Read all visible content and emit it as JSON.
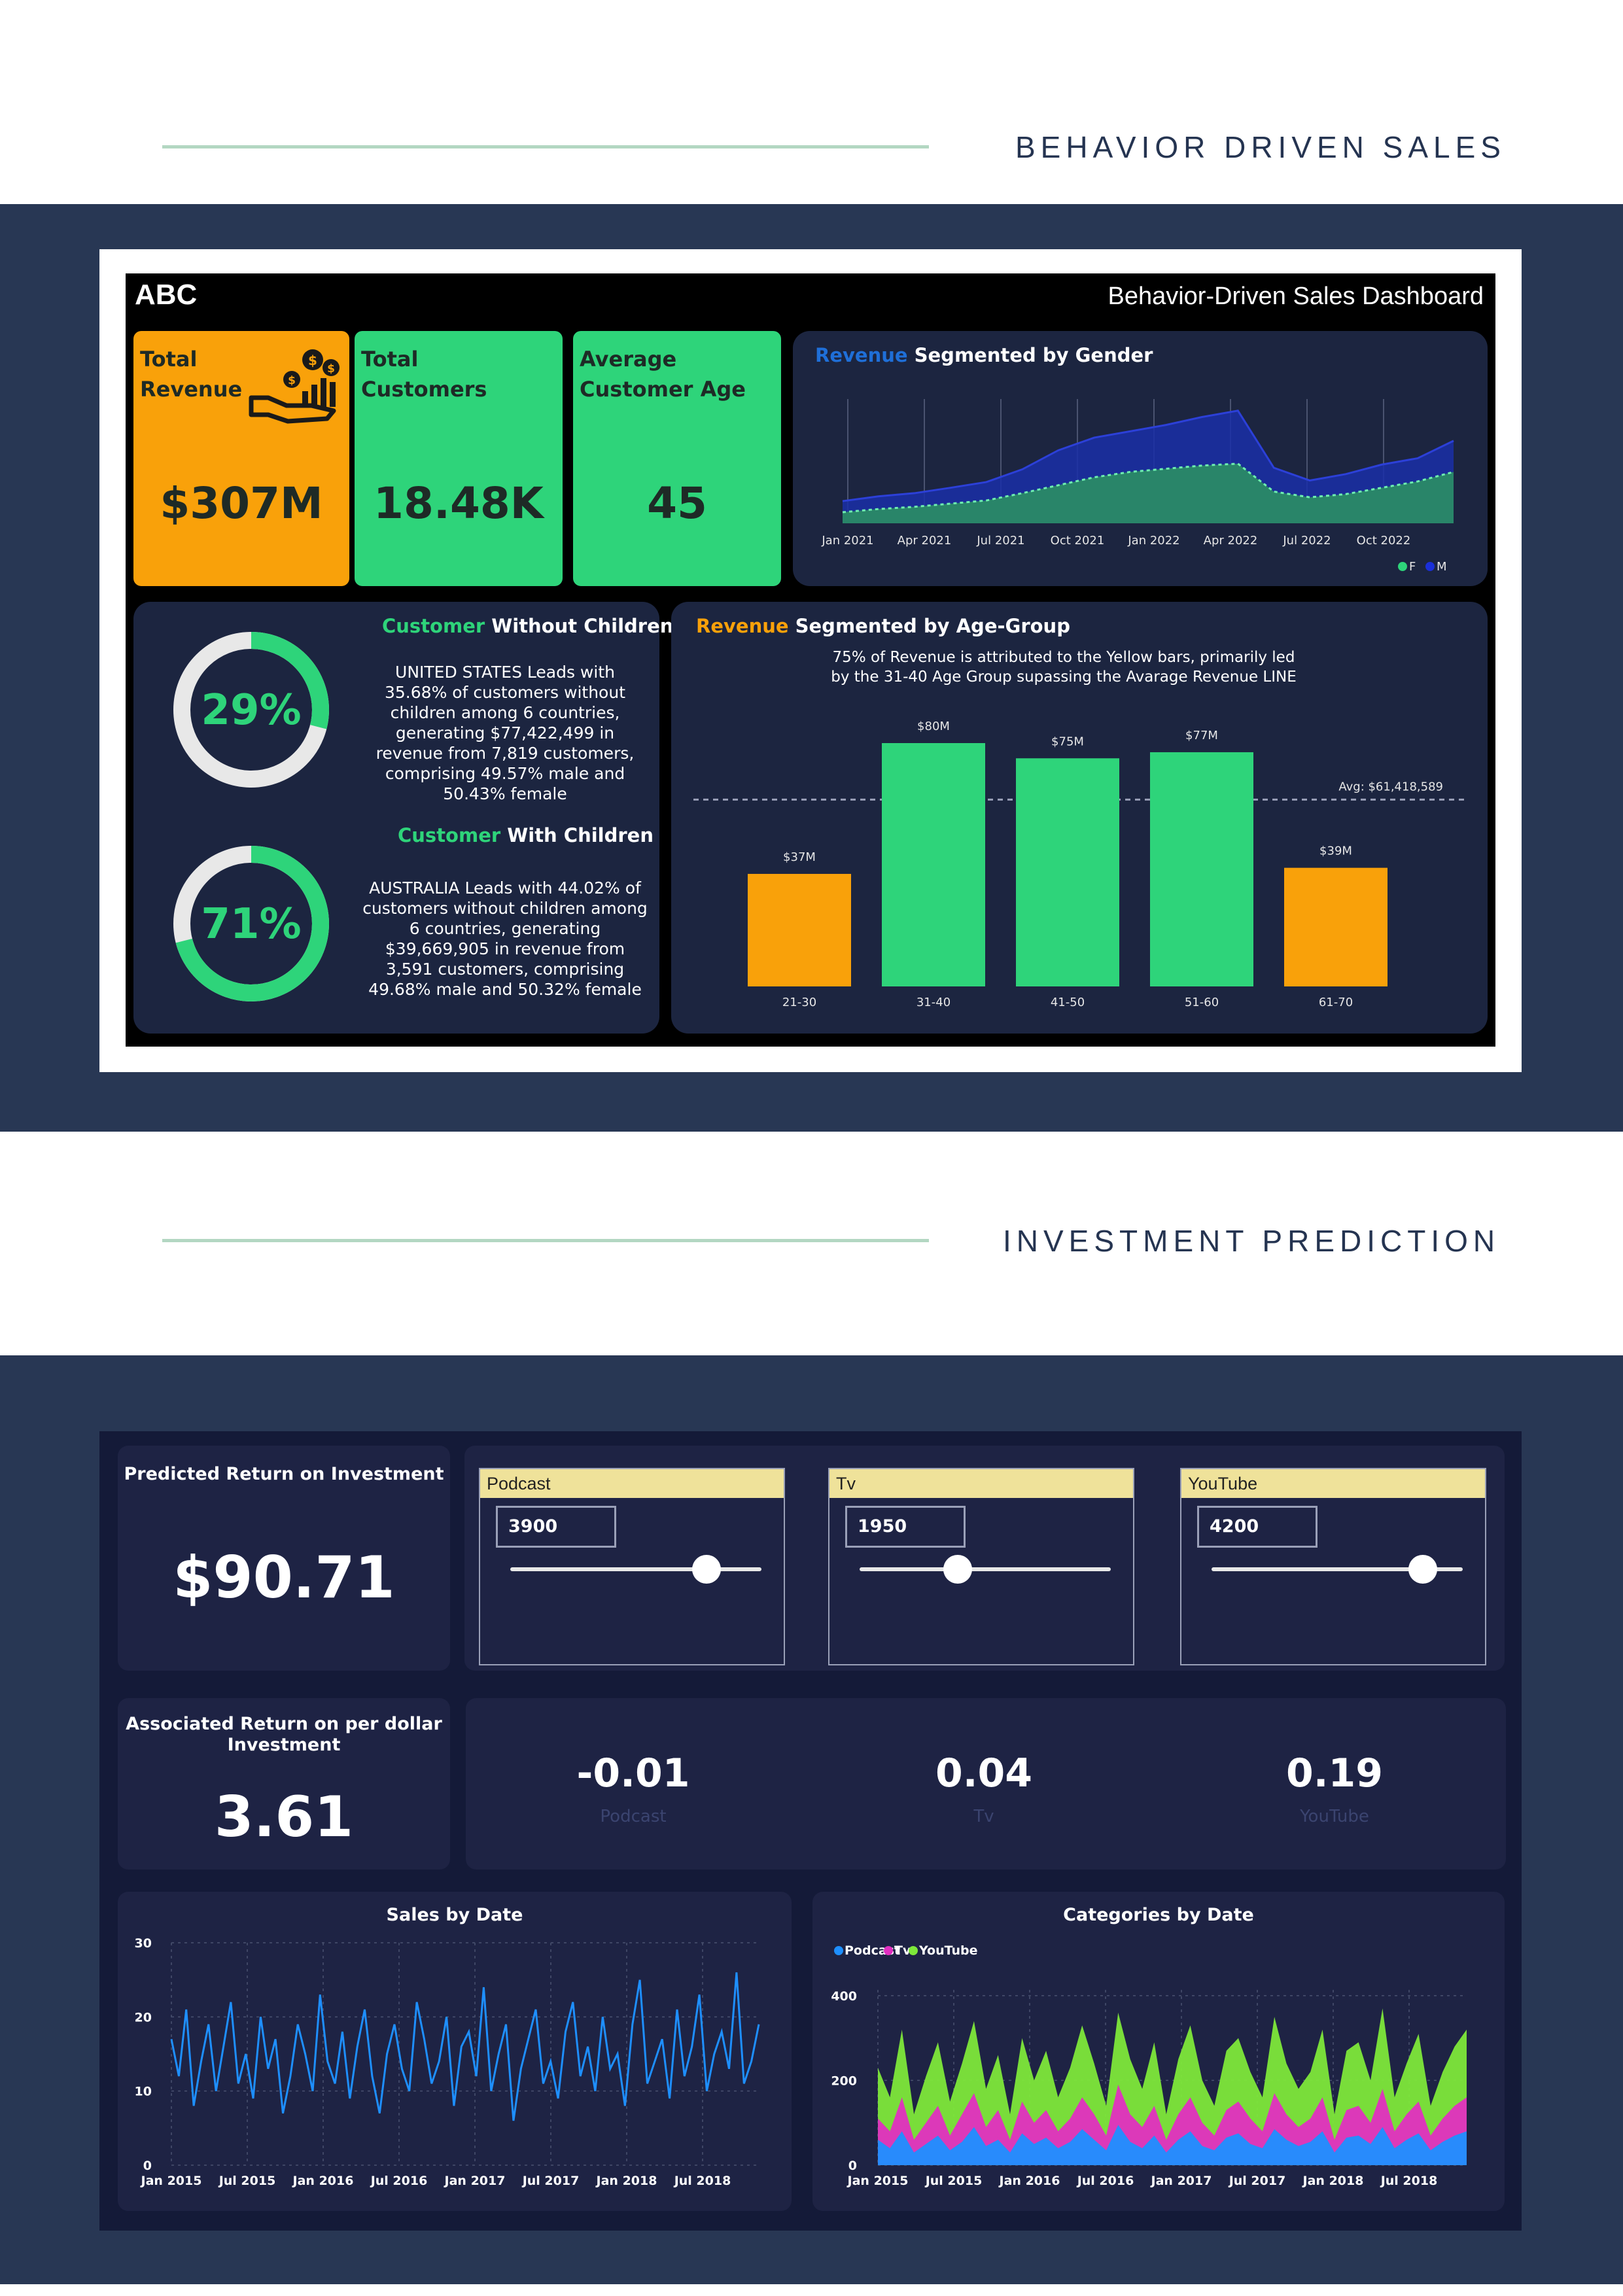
{
  "section1": {
    "title": "BEHAVIOR DRIVEN SALES"
  },
  "section2": {
    "title": "INVESTMENT PREDICTION"
  },
  "dashboard1": {
    "brand": "ABC",
    "title": "Behavior-Driven Sales Dashboard",
    "kpis": [
      {
        "label": "Total\nRevenue",
        "value": "$307M",
        "color": "#f9a10a",
        "icon": "money-hand-icon"
      },
      {
        "label": "Total\nCustomers",
        "value": "18.48K",
        "color": "#2ed47a"
      },
      {
        "label": "Average\nCustomer Age",
        "value": "45",
        "color": "#2ed47a"
      }
    ],
    "gender_panel": {
      "title_highlight": "Revenue",
      "title_rest": " Segmented by Gender",
      "legend_f": "F",
      "legend_m": "M"
    },
    "without_children": {
      "title_highlight": "Customer",
      "title_rest": " Without Children",
      "percent": "29%",
      "fraction": 0.29,
      "text": "UNITED STATES Leads with 35.68% of customers without children among 6 countries, generating $77,422,499 in revenue from 7,819 customers, comprising 49.57% male and 50.43% female"
    },
    "with_children": {
      "title_highlight": "Customer",
      "title_rest": " With Children",
      "percent": "71%",
      "fraction": 0.71,
      "text": "AUSTRALIA Leads with 44.02% of customers without children among 6 countries, generating $39,669,905 in revenue from 3,591 customers, comprising 49.68% male and 50.32% female"
    },
    "age_panel": {
      "title_highlight": "Revenue",
      "title_rest": " Segmented by Age-Group",
      "subtitle_line1": "75% of Revenue is attributed to the Yellow bars, primarily led",
      "subtitle_line2": "by the 31-40 Age Group supassing the Avarage Revenue LINE"
    },
    "colors": {
      "orange": "#f9a10a",
      "green": "#2ed47a",
      "blue": "#1a2fa8",
      "panel": "#1c2540"
    }
  },
  "chart_data": [
    {
      "type": "area",
      "title": "Revenue Segmented by Gender",
      "x_ticks": [
        "Jan 2021",
        "Apr 2021",
        "Jul 2021",
        "Oct 2021",
        "Jan 2022",
        "Apr 2022",
        "Jul 2022",
        "Oct 2022"
      ],
      "series": [
        {
          "name": "F",
          "color": "#2ed47a",
          "values": [
            0.35,
            0.45,
            0.52,
            0.62,
            0.72,
            0.95,
            1.2,
            1.45,
            1.62,
            1.72,
            1.82,
            1.88,
            1.0,
            0.82,
            0.92,
            1.12,
            1.32,
            1.62
          ]
        },
        {
          "name": "M",
          "color": "#1a2fa8",
          "values": [
            0.7,
            0.85,
            0.95,
            1.12,
            1.3,
            1.7,
            2.3,
            2.7,
            2.9,
            3.1,
            3.35,
            3.55,
            1.75,
            1.35,
            1.55,
            1.85,
            2.05,
            2.6
          ]
        }
      ]
    },
    {
      "type": "bar",
      "title": "Revenue Segmented by Age-Group",
      "categories": [
        "21-30",
        "31-40",
        "41-50",
        "51-60",
        "61-70"
      ],
      "values": [
        37,
        80,
        75,
        77,
        39
      ],
      "data_labels": [
        "$37M",
        "$80M",
        "$75M",
        "$77M",
        "$39M"
      ],
      "colors": [
        "#f9a10a",
        "#2ed47a",
        "#2ed47a",
        "#2ed47a",
        "#f9a10a"
      ],
      "average": 61.418589,
      "average_label": "Avg: $61,418,589",
      "ylim": [
        0,
        90
      ]
    },
    {
      "type": "line",
      "title": "Sales by Date",
      "x_ticks": [
        "Jan 2015",
        "Jul 2015",
        "Jan 2016",
        "Jul 2016",
        "Jan 2017",
        "Jul 2017",
        "Jan 2018",
        "Jul 2018"
      ],
      "y_ticks": [
        "0",
        "10",
        "20",
        "30"
      ],
      "ylim": [
        0,
        30
      ],
      "series": [
        {
          "name": "Sales",
          "color": "#1e8fff",
          "values": [
            17,
            12,
            21,
            8,
            14,
            19,
            10,
            16,
            22,
            11,
            15,
            9,
            20,
            13,
            17,
            7,
            12,
            19,
            15,
            10,
            23,
            14,
            11,
            18,
            9,
            16,
            21,
            12,
            7,
            15,
            19,
            13,
            10,
            22,
            17,
            11,
            14,
            20,
            8,
            16,
            18,
            12,
            24,
            10,
            15,
            19,
            6,
            13,
            17,
            21,
            11,
            14,
            9,
            18,
            22,
            12,
            16,
            10,
            20,
            13,
            15,
            8,
            19,
            25,
            11,
            14,
            17,
            9,
            21,
            12,
            16,
            23,
            10,
            15,
            18,
            13,
            26,
            11,
            14,
            19
          ]
        }
      ]
    },
    {
      "type": "area",
      "title": "Categories by Date",
      "x_ticks": [
        "Jan 2015",
        "Jul 2015",
        "Jan 2016",
        "Jul 2016",
        "Jan 2017",
        "Jul 2017",
        "Jan 2018",
        "Jul 2018"
      ],
      "y_ticks": [
        "0",
        "200",
        "400"
      ],
      "ylim": [
        0,
        460
      ],
      "series": [
        {
          "name": "Podcast",
          "color": "#1e8fff",
          "values": [
            60,
            40,
            80,
            30,
            50,
            70,
            35,
            55,
            90,
            45,
            60,
            30,
            75,
            50,
            65,
            40,
            55,
            85,
            60,
            35,
            95,
            55,
            40,
            70,
            30,
            60,
            80,
            45,
            35,
            65,
            75,
            50,
            40,
            85,
            60,
            45,
            55,
            80,
            30,
            65,
            70,
            50,
            90,
            40,
            60,
            75,
            35,
            55,
            70,
            80
          ]
        },
        {
          "name": "Tv",
          "color": "#e12fc0",
          "values": [
            110,
            80,
            160,
            60,
            100,
            140,
            70,
            120,
            170,
            90,
            130,
            60,
            150,
            100,
            130,
            80,
            110,
            160,
            120,
            70,
            190,
            120,
            90,
            140,
            60,
            120,
            160,
            100,
            70,
            130,
            150,
            110,
            80,
            170,
            120,
            90,
            110,
            160,
            60,
            130,
            140,
            100,
            180,
            80,
            120,
            150,
            70,
            110,
            140,
            160
          ]
        },
        {
          "name": "YouTube",
          "color": "#7ee83a",
          "values": [
            230,
            160,
            320,
            120,
            210,
            290,
            150,
            240,
            340,
            180,
            260,
            120,
            300,
            200,
            270,
            160,
            230,
            330,
            240,
            140,
            360,
            250,
            180,
            290,
            120,
            250,
            330,
            200,
            140,
            270,
            300,
            220,
            160,
            350,
            240,
            180,
            220,
            320,
            120,
            270,
            290,
            200,
            370,
            160,
            240,
            310,
            140,
            220,
            280,
            320
          ]
        }
      ]
    }
  ],
  "dashboard2": {
    "predicted_title": "Predicted Return on Investment",
    "predicted_value": "$90.71",
    "sliders": [
      {
        "label": "Podcast",
        "value": "3900",
        "fraction": 0.78
      },
      {
        "label": "Tv",
        "value": "1950",
        "fraction": 0.39
      },
      {
        "label": "YouTube",
        "value": "4200",
        "fraction": 0.84
      }
    ],
    "assoc_title_line1": "Associated Return on per dollar",
    "assoc_title_line2": "Investment",
    "assoc_value": "3.61",
    "coefficients": [
      {
        "value": "-0.01",
        "label": "Podcast"
      },
      {
        "value": "0.04",
        "label": "Tv"
      },
      {
        "value": "0.19",
        "label": "YouTube"
      }
    ],
    "sales_title": "Sales by Date",
    "categories_title": "Categories by Date",
    "legend": [
      "Podcast",
      "Tv",
      "YouTube"
    ]
  }
}
